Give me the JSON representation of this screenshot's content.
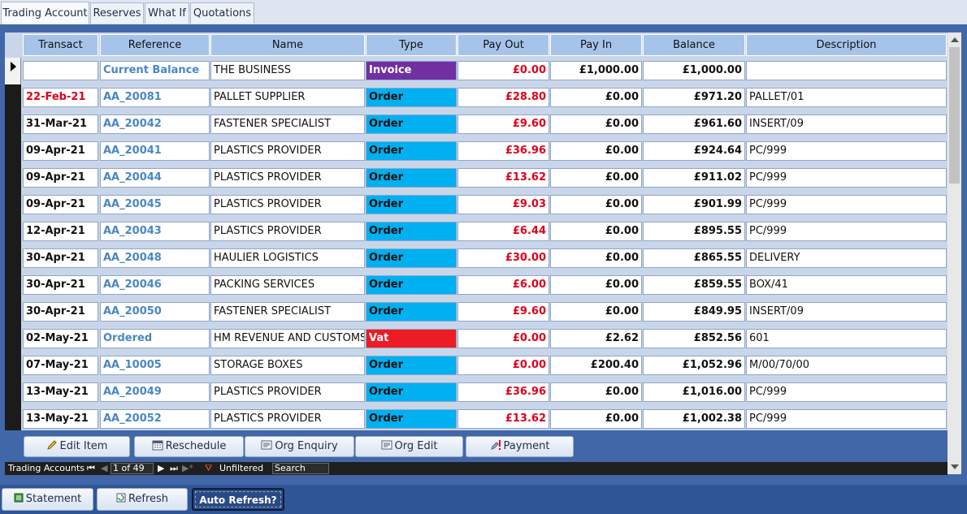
{
  "tabs": [
    "Trading Account",
    "Reserves",
    "What If",
    "Quotations"
  ],
  "columns": [
    "Transact",
    "Reference",
    "Name",
    "Type",
    "Pay Out",
    "Pay In",
    "Balance",
    "Description"
  ],
  "colors": {
    "invoice": "#7030a0",
    "order": "#00b0f0",
    "vat": "#ed1c24",
    "payout": "#e0001b",
    "reference": "#4a86c5",
    "frame": "#4167a8"
  },
  "rows": [
    {
      "transact": "",
      "reference": "Current Balance",
      "name": "THE BUSINESS",
      "type": "Invoice",
      "payout": "£0.00",
      "payin": "£1,000.00",
      "balance": "£1,000.00",
      "description": ""
    },
    {
      "transact": "22-Feb-21",
      "reference": "AA_20081",
      "name": "PALLET SUPPLIER",
      "type": "Order",
      "payout": "£28.80",
      "payin": "£0.00",
      "balance": "£971.20",
      "description": "PALLET/01"
    },
    {
      "transact": "31-Mar-21",
      "reference": "AA_20042",
      "name": "FASTENER SPECIALIST",
      "type": "Order",
      "payout": "£9.60",
      "payin": "£0.00",
      "balance": "£961.60",
      "description": "INSERT/09"
    },
    {
      "transact": "09-Apr-21",
      "reference": "AA_20041",
      "name": "PLASTICS PROVIDER",
      "type": "Order",
      "payout": "£36.96",
      "payin": "£0.00",
      "balance": "£924.64",
      "description": "PC/999"
    },
    {
      "transact": "09-Apr-21",
      "reference": "AA_20044",
      "name": "PLASTICS PROVIDER",
      "type": "Order",
      "payout": "£13.62",
      "payin": "£0.00",
      "balance": "£911.02",
      "description": "PC/999"
    },
    {
      "transact": "09-Apr-21",
      "reference": "AA_20045",
      "name": "PLASTICS PROVIDER",
      "type": "Order",
      "payout": "£9.03",
      "payin": "£0.00",
      "balance": "£901.99",
      "description": "PC/999"
    },
    {
      "transact": "12-Apr-21",
      "reference": "AA_20043",
      "name": "PLASTICS PROVIDER",
      "type": "Order",
      "payout": "£6.44",
      "payin": "£0.00",
      "balance": "£895.55",
      "description": "PC/999"
    },
    {
      "transact": "30-Apr-21",
      "reference": "AA_20048",
      "name": "HAULIER LOGISTICS",
      "type": "Order",
      "payout": "£30.00",
      "payin": "£0.00",
      "balance": "£865.55",
      "description": "DELIVERY"
    },
    {
      "transact": "30-Apr-21",
      "reference": "AA_20046",
      "name": "PACKING SERVICES",
      "type": "Order",
      "payout": "£6.00",
      "payin": "£0.00",
      "balance": "£859.55",
      "description": "BOX/41"
    },
    {
      "transact": "30-Apr-21",
      "reference": "AA_20050",
      "name": "FASTENER SPECIALIST",
      "type": "Order",
      "payout": "£9.60",
      "payin": "£0.00",
      "balance": "£849.95",
      "description": "INSERT/09"
    },
    {
      "transact": "02-May-21",
      "reference": "Ordered",
      "name": "HM REVENUE AND CUSTOMS",
      "type": "Vat",
      "payout": "£0.00",
      "payin": "£2.62",
      "balance": "£852.56",
      "description": "601"
    },
    {
      "transact": "07-May-21",
      "reference": "AA_10005",
      "name": "STORAGE BOXES",
      "type": "Order",
      "payout": "£0.00",
      "payin": "£200.40",
      "balance": "£1,052.96",
      "description": "M/00/70/00"
    },
    {
      "transact": "13-May-21",
      "reference": "AA_20049",
      "name": "PLASTICS PROVIDER",
      "type": "Order",
      "payout": "£36.96",
      "payin": "£0.00",
      "balance": "£1,016.00",
      "description": "PC/999"
    },
    {
      "transact": "13-May-21",
      "reference": "AA_20052",
      "name": "PLASTICS PROVIDER",
      "type": "Order",
      "payout": "£13.62",
      "payin": "£0.00",
      "balance": "£1,002.38",
      "description": "PC/999"
    }
  ],
  "actions": {
    "edit_item": "Edit Item",
    "reschedule": "Reschedule",
    "org_enquiry": "Org Enquiry",
    "org_edit": "Org Edit",
    "payment": "Payment"
  },
  "navigator": {
    "name": "Trading Accounts",
    "record": "1 of 49",
    "filter": "Unfiltered",
    "search_placeholder": "Search"
  },
  "footer": {
    "statement": "Statement",
    "refresh": "Refresh",
    "auto_refresh": "Auto Refresh?"
  }
}
